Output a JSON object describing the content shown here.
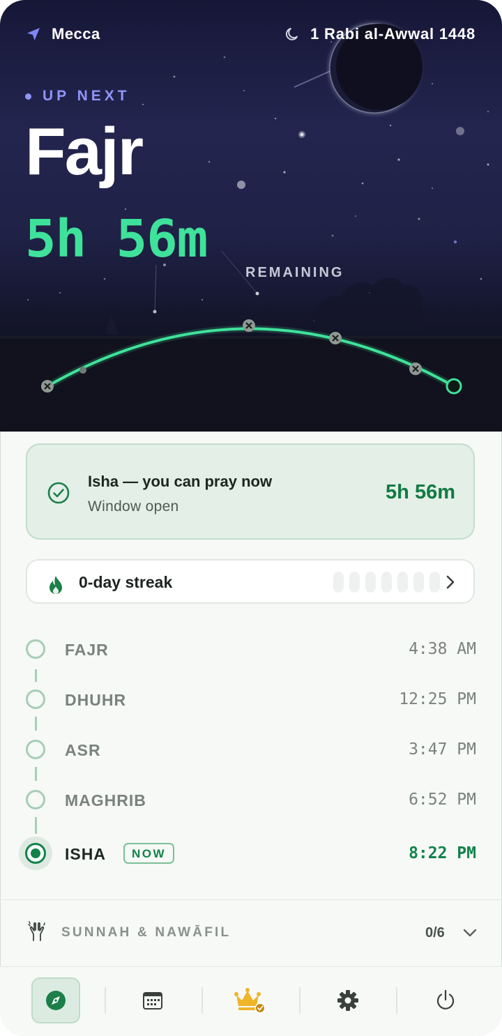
{
  "header": {
    "location": "Mecca",
    "hijri_date": "1 Rabi al-Awwal 1448"
  },
  "hero": {
    "up_next_label": "UP NEXT",
    "next_prayer": "Fajr",
    "countdown": "5h 56m",
    "remaining_label": "REMAINING"
  },
  "current_card": {
    "title": "Isha — you can pray now",
    "subtitle": "Window open",
    "time_left": "5h 56m"
  },
  "streak": {
    "label": "0-day streak",
    "days_completed": 0,
    "days_total": 7
  },
  "prayers": [
    {
      "name": "FAJR",
      "time": "4:38 AM",
      "active": false
    },
    {
      "name": "DHUHR",
      "time": "12:25 PM",
      "active": false
    },
    {
      "name": "ASR",
      "time": "3:47 PM",
      "active": false
    },
    {
      "name": "MAGHRIB",
      "time": "6:52 PM",
      "active": false
    },
    {
      "name": "ISHA",
      "time": "8:22 PM",
      "active": true,
      "badge": "NOW"
    }
  ],
  "sunnah": {
    "label": "SUNNAH & NAWĀFIL",
    "count": "0/6"
  },
  "tabs": [
    {
      "icon": "compass-icon",
      "active": true
    },
    {
      "icon": "calendar-icon",
      "active": false
    },
    {
      "icon": "crown-icon",
      "active": false
    },
    {
      "icon": "gear-icon",
      "active": false
    },
    {
      "icon": "power-icon",
      "active": false
    }
  ],
  "colors": {
    "accent_green": "#3fe29a",
    "active_green": "#11834a",
    "up_next_purple": "#8f95f7",
    "hero_dark": "#1f2146"
  }
}
